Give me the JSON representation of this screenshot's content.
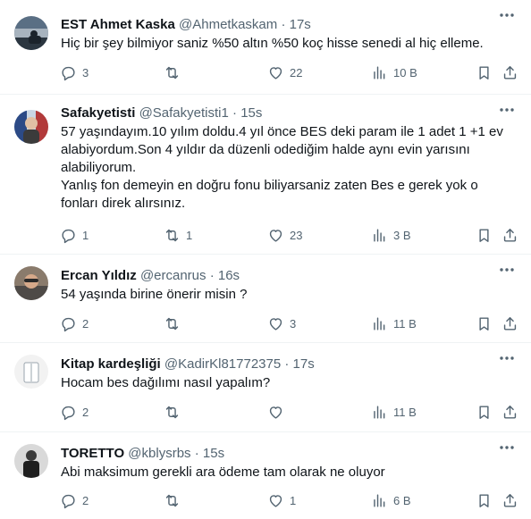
{
  "tweets": [
    {
      "name": "EST Ahmet Kaska",
      "handle": "@Ahmetkaskam",
      "sep": "·",
      "time": "17s",
      "lines": [
        "Hiç bir şey bilmiyor saniz %50 altın %50 koç  hisse senedi al hiç elleme."
      ],
      "replies": "3",
      "retweets": "",
      "likes": "22",
      "views": "10 B"
    },
    {
      "name": "Safakyetisti",
      "handle": "@Safakyetisti1",
      "sep": "·",
      "time": "15s",
      "lines": [
        "57 yaşındayım.10 yılım doldu.4 yıl önce BES deki param ile 1 adet 1 +1 ev alabiyordum.Son 4 yıldır da düzenli odediğim halde aynı evin yarısını alabiliyorum.",
        "Yanlış fon demeyin en doğru fonu biliyarsaniz zaten Bes e gerek yok o fonları direk alırsınız."
      ],
      "replies": "1",
      "retweets": "1",
      "likes": "23",
      "views": "3 B"
    },
    {
      "name": "Ercan Yıldız",
      "handle": "@ercanrus",
      "sep": "·",
      "time": "16s",
      "lines": [
        "54 yaşında birine önerir misin ?"
      ],
      "replies": "2",
      "retweets": "",
      "likes": "3",
      "views": "11 B"
    },
    {
      "name": "Kitap kardeşliği",
      "handle": "@KadirKl81772375",
      "sep": "·",
      "time": "17s",
      "lines": [
        "Hocam bes dağılımı nasıl yapalım?"
      ],
      "replies": "2",
      "retweets": "",
      "likes": "",
      "views": "11 B"
    },
    {
      "name": "TORETTO",
      "handle": "@kblysrbs",
      "sep": "·",
      "time": "15s",
      "lines": [
        "Abi maksimum gerekli ara ödeme tam olarak ne oluyor"
      ],
      "replies": "2",
      "retweets": "",
      "likes": "1",
      "views": "6 B"
    }
  ],
  "icons": {
    "more": "more-horizontal-icon",
    "reply": "reply-bubble-icon",
    "retweet": "retweet-icon",
    "like": "heart-icon",
    "views": "views-chart-icon",
    "bookmark": "bookmark-icon",
    "share": "share-icon"
  },
  "colors": {
    "text": "#0f1419",
    "secondary": "#536471",
    "divider": "#eff3f4"
  }
}
